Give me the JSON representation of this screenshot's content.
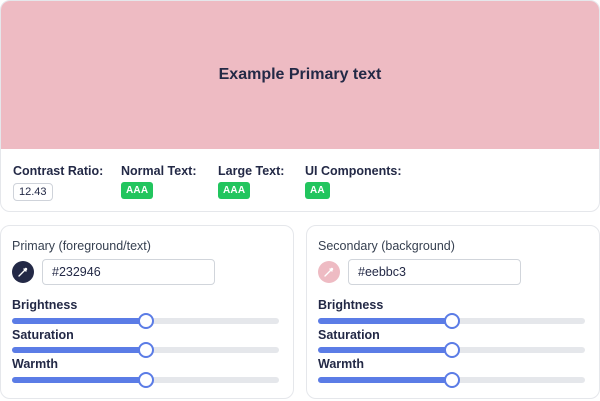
{
  "preview": {
    "text": "Example Primary text",
    "background": "#eebbc3",
    "foreground": "#232946"
  },
  "contrast": {
    "ratio_label": "Contrast Ratio:",
    "ratio_value": "12.43",
    "normal_label": "Normal Text:",
    "normal_badge": "AAA",
    "large_label": "Large Text:",
    "large_badge": "AAA",
    "ui_label": "UI Components:",
    "ui_badge": "AA",
    "badge_color": "#22c55e"
  },
  "primary": {
    "title": "Primary (foreground/text)",
    "hex": "#232946",
    "swatch_color": "#232946",
    "swatch_icon": "pipette-icon",
    "sliders": [
      {
        "label": "Brightness",
        "value": 0.5
      },
      {
        "label": "Saturation",
        "value": 0.5
      },
      {
        "label": "Warmth",
        "value": 0.5
      }
    ]
  },
  "secondary": {
    "title": "Secondary (background)",
    "hex": "#eebbc3",
    "swatch_color": "#eebbc3",
    "swatch_icon": "pipette-icon",
    "sliders": [
      {
        "label": "Brightness",
        "value": 0.5
      },
      {
        "label": "Saturation",
        "value": 0.5
      },
      {
        "label": "Warmth",
        "value": 0.5
      }
    ]
  },
  "accent_color": "#5b7ce6"
}
